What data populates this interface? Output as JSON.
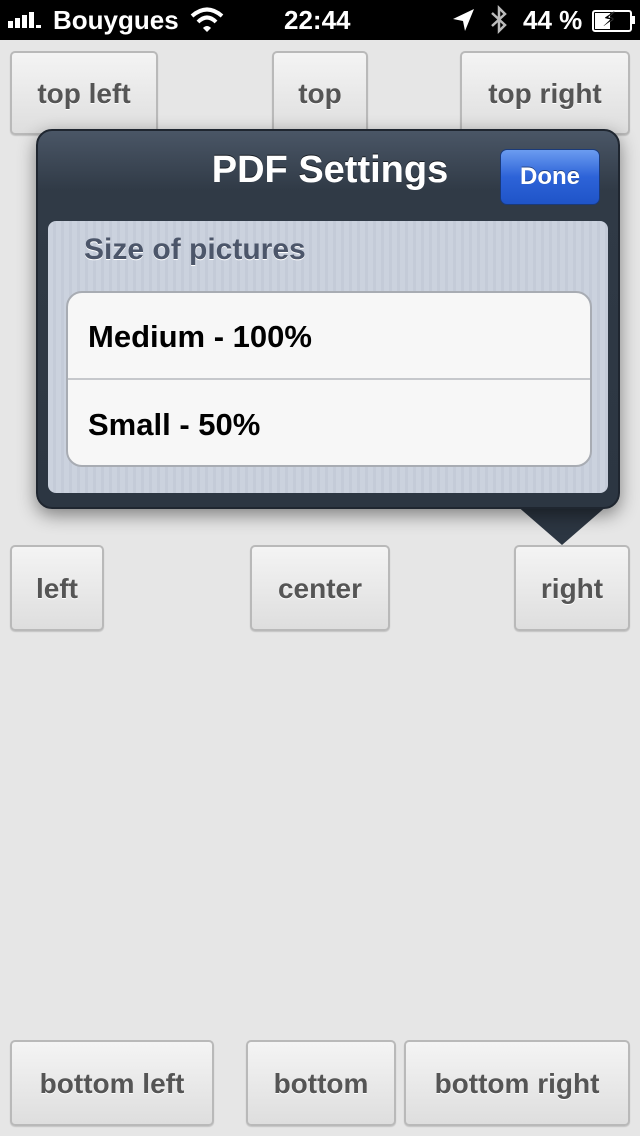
{
  "status_bar": {
    "carrier": "Bouygues",
    "time": "22:44",
    "battery_percent": "44 %",
    "signal_bars": 5
  },
  "buttons": {
    "top_left": "top left",
    "top": "top",
    "top_right": "top right",
    "left": "left",
    "center": "center",
    "right": "right",
    "bottom_left": "bottom left",
    "bottom": "bottom",
    "bottom_right": "bottom right"
  },
  "popover": {
    "title": "PDF Settings",
    "done_label": "Done",
    "section_header": "Size of pictures",
    "options": [
      {
        "label": "Medium - 100%"
      },
      {
        "label": "Small - 50%"
      }
    ]
  },
  "colors": {
    "background": "#e6e6e6",
    "popover": "#2c3642",
    "done_button": "#2d63d8",
    "section_text": "#4c566a"
  },
  "icons": [
    "signal-icon",
    "wifi-icon",
    "location-arrow-icon",
    "bluetooth-icon",
    "battery-charging-icon"
  ]
}
